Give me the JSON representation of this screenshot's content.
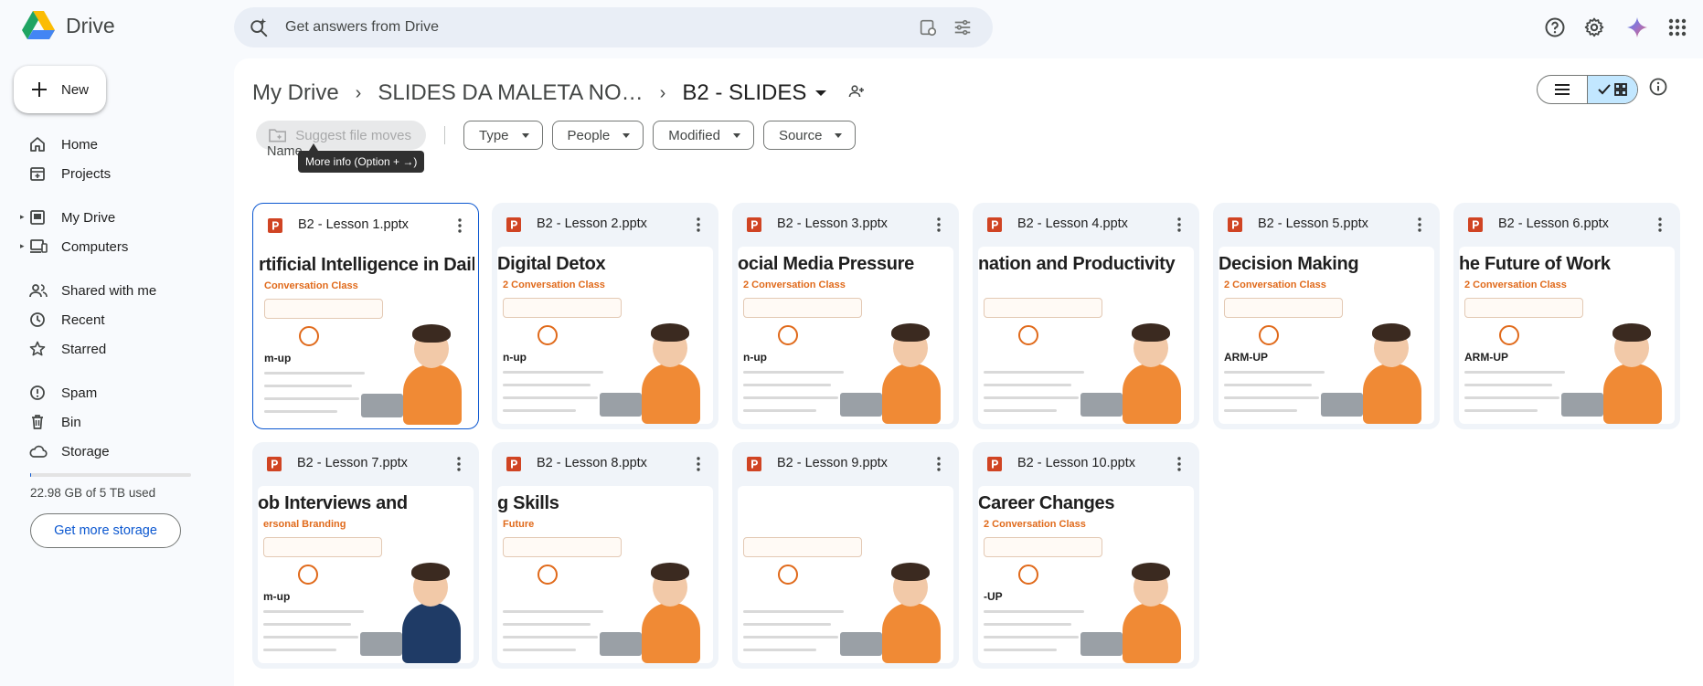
{
  "app": {
    "name": "Drive"
  },
  "search": {
    "placeholder": "Get answers from Drive"
  },
  "new_button": {
    "label": "New"
  },
  "sidebar": {
    "items": [
      {
        "label": "Home",
        "icon": "home-icon"
      },
      {
        "label": "Projects",
        "icon": "projects-icon"
      },
      {
        "label": "My Drive",
        "icon": "my-drive-icon"
      },
      {
        "label": "Computers",
        "icon": "computers-icon"
      },
      {
        "label": "Shared with me",
        "icon": "shared-icon"
      },
      {
        "label": "Recent",
        "icon": "recent-icon"
      },
      {
        "label": "Starred",
        "icon": "star-icon"
      },
      {
        "label": "Spam",
        "icon": "spam-icon"
      },
      {
        "label": "Bin",
        "icon": "bin-icon"
      },
      {
        "label": "Storage",
        "icon": "cloud-icon"
      }
    ],
    "storage_text": "22.98 GB of 5 TB used",
    "storage_used_fraction": 0.0045,
    "get_more_storage": "Get more storage"
  },
  "breadcrumb": {
    "items": [
      "My Drive",
      "SLIDES DA MALETA NO…",
      "B2 - SLIDES"
    ]
  },
  "filters": {
    "suggest": "Suggest file moves",
    "chips": [
      "Type",
      "People",
      "Modified",
      "Source"
    ]
  },
  "list": {
    "name_header": "Name",
    "tooltip": "More info (Option + →)"
  },
  "files": [
    {
      "name": "B2 - Lesson 1.pptx",
      "thumb_title": "rtificial Intelligence in Daily Life",
      "thumb_sub": "Conversation Class",
      "thumb_warm": "m-up"
    },
    {
      "name": "B2 - Lesson 2.pptx",
      "thumb_title": "Digital Detox",
      "thumb_sub": "2 Conversation Class",
      "thumb_warm": "n-up"
    },
    {
      "name": "B2 - Lesson 3.pptx",
      "thumb_title": "ocial Media Pressure",
      "thumb_sub": "2 Conversation Class",
      "thumb_warm": "n-up"
    },
    {
      "name": "B2 - Lesson 4.pptx",
      "thumb_title": "nation and Productivity",
      "thumb_sub": "",
      "thumb_warm": ""
    },
    {
      "name": "B2 - Lesson 5.pptx",
      "thumb_title": "Decision Making",
      "thumb_sub": "2 Conversation Class",
      "thumb_warm": "ARM-UP"
    },
    {
      "name": "B2 - Lesson 6.pptx",
      "thumb_title": "he Future of Work",
      "thumb_sub": "2 Conversation Class",
      "thumb_warm": "ARM-UP"
    },
    {
      "name": "B2 - Lesson 7.pptx",
      "thumb_title": "ob Interviews and",
      "thumb_sub": "ersonal Branding",
      "thumb_warm": "m-up"
    },
    {
      "name": "B2 - Lesson 8.pptx",
      "thumb_title": "g Skills",
      "thumb_sub": "Future",
      "thumb_warm": ""
    },
    {
      "name": "B2 - Lesson 9.pptx",
      "thumb_title": "",
      "thumb_sub": "",
      "thumb_warm": ""
    },
    {
      "name": "B2 - Lesson 10.pptx",
      "thumb_title": "Career Changes",
      "thumb_sub": "2 Conversation Class",
      "thumb_warm": "-UP"
    }
  ]
}
